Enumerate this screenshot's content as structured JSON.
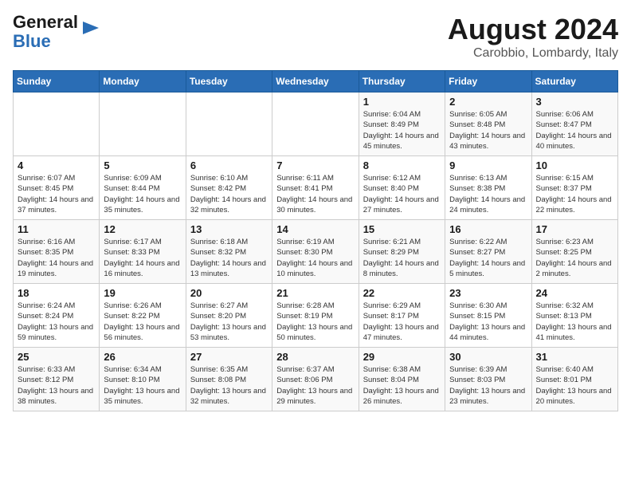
{
  "header": {
    "logo_line1": "General",
    "logo_line2": "Blue",
    "title": "August 2024",
    "subtitle": "Carobbio, Lombardy, Italy"
  },
  "days_of_week": [
    "Sunday",
    "Monday",
    "Tuesday",
    "Wednesday",
    "Thursday",
    "Friday",
    "Saturday"
  ],
  "weeks": [
    [
      {
        "day": "",
        "info": ""
      },
      {
        "day": "",
        "info": ""
      },
      {
        "day": "",
        "info": ""
      },
      {
        "day": "",
        "info": ""
      },
      {
        "day": "1",
        "info": "Sunrise: 6:04 AM\nSunset: 8:49 PM\nDaylight: 14 hours and 45 minutes."
      },
      {
        "day": "2",
        "info": "Sunrise: 6:05 AM\nSunset: 8:48 PM\nDaylight: 14 hours and 43 minutes."
      },
      {
        "day": "3",
        "info": "Sunrise: 6:06 AM\nSunset: 8:47 PM\nDaylight: 14 hours and 40 minutes."
      }
    ],
    [
      {
        "day": "4",
        "info": "Sunrise: 6:07 AM\nSunset: 8:45 PM\nDaylight: 14 hours and 37 minutes."
      },
      {
        "day": "5",
        "info": "Sunrise: 6:09 AM\nSunset: 8:44 PM\nDaylight: 14 hours and 35 minutes."
      },
      {
        "day": "6",
        "info": "Sunrise: 6:10 AM\nSunset: 8:42 PM\nDaylight: 14 hours and 32 minutes."
      },
      {
        "day": "7",
        "info": "Sunrise: 6:11 AM\nSunset: 8:41 PM\nDaylight: 14 hours and 30 minutes."
      },
      {
        "day": "8",
        "info": "Sunrise: 6:12 AM\nSunset: 8:40 PM\nDaylight: 14 hours and 27 minutes."
      },
      {
        "day": "9",
        "info": "Sunrise: 6:13 AM\nSunset: 8:38 PM\nDaylight: 14 hours and 24 minutes."
      },
      {
        "day": "10",
        "info": "Sunrise: 6:15 AM\nSunset: 8:37 PM\nDaylight: 14 hours and 22 minutes."
      }
    ],
    [
      {
        "day": "11",
        "info": "Sunrise: 6:16 AM\nSunset: 8:35 PM\nDaylight: 14 hours and 19 minutes."
      },
      {
        "day": "12",
        "info": "Sunrise: 6:17 AM\nSunset: 8:33 PM\nDaylight: 14 hours and 16 minutes."
      },
      {
        "day": "13",
        "info": "Sunrise: 6:18 AM\nSunset: 8:32 PM\nDaylight: 14 hours and 13 minutes."
      },
      {
        "day": "14",
        "info": "Sunrise: 6:19 AM\nSunset: 8:30 PM\nDaylight: 14 hours and 10 minutes."
      },
      {
        "day": "15",
        "info": "Sunrise: 6:21 AM\nSunset: 8:29 PM\nDaylight: 14 hours and 8 minutes."
      },
      {
        "day": "16",
        "info": "Sunrise: 6:22 AM\nSunset: 8:27 PM\nDaylight: 14 hours and 5 minutes."
      },
      {
        "day": "17",
        "info": "Sunrise: 6:23 AM\nSunset: 8:25 PM\nDaylight: 14 hours and 2 minutes."
      }
    ],
    [
      {
        "day": "18",
        "info": "Sunrise: 6:24 AM\nSunset: 8:24 PM\nDaylight: 13 hours and 59 minutes."
      },
      {
        "day": "19",
        "info": "Sunrise: 6:26 AM\nSunset: 8:22 PM\nDaylight: 13 hours and 56 minutes."
      },
      {
        "day": "20",
        "info": "Sunrise: 6:27 AM\nSunset: 8:20 PM\nDaylight: 13 hours and 53 minutes."
      },
      {
        "day": "21",
        "info": "Sunrise: 6:28 AM\nSunset: 8:19 PM\nDaylight: 13 hours and 50 minutes."
      },
      {
        "day": "22",
        "info": "Sunrise: 6:29 AM\nSunset: 8:17 PM\nDaylight: 13 hours and 47 minutes."
      },
      {
        "day": "23",
        "info": "Sunrise: 6:30 AM\nSunset: 8:15 PM\nDaylight: 13 hours and 44 minutes."
      },
      {
        "day": "24",
        "info": "Sunrise: 6:32 AM\nSunset: 8:13 PM\nDaylight: 13 hours and 41 minutes."
      }
    ],
    [
      {
        "day": "25",
        "info": "Sunrise: 6:33 AM\nSunset: 8:12 PM\nDaylight: 13 hours and 38 minutes."
      },
      {
        "day": "26",
        "info": "Sunrise: 6:34 AM\nSunset: 8:10 PM\nDaylight: 13 hours and 35 minutes."
      },
      {
        "day": "27",
        "info": "Sunrise: 6:35 AM\nSunset: 8:08 PM\nDaylight: 13 hours and 32 minutes."
      },
      {
        "day": "28",
        "info": "Sunrise: 6:37 AM\nSunset: 8:06 PM\nDaylight: 13 hours and 29 minutes."
      },
      {
        "day": "29",
        "info": "Sunrise: 6:38 AM\nSunset: 8:04 PM\nDaylight: 13 hours and 26 minutes."
      },
      {
        "day": "30",
        "info": "Sunrise: 6:39 AM\nSunset: 8:03 PM\nDaylight: 13 hours and 23 minutes."
      },
      {
        "day": "31",
        "info": "Sunrise: 6:40 AM\nSunset: 8:01 PM\nDaylight: 13 hours and 20 minutes."
      }
    ]
  ]
}
